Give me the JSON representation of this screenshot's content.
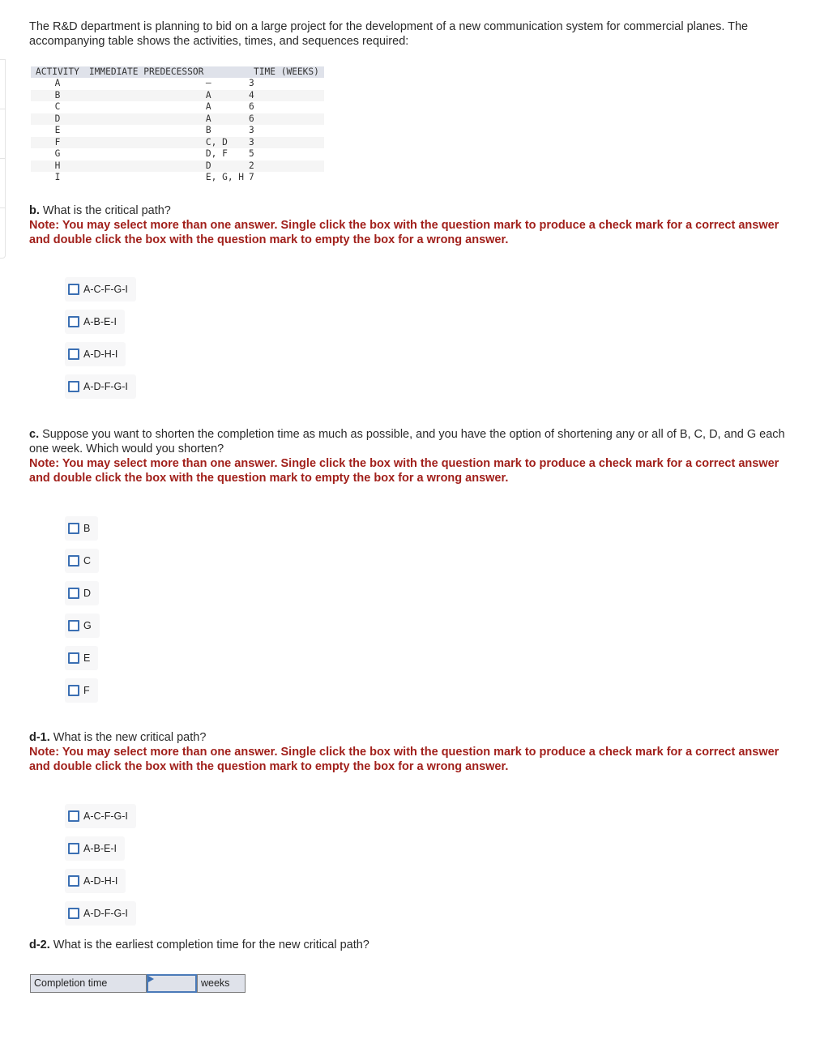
{
  "intro": "The R&D department is planning to bid on a large project for the development of a new communication system for commercial planes. The accompanying table shows the activities, times, and sequences required:",
  "table": {
    "headers": [
      "ACTIVITY",
      "IMMEDIATE PREDECESSOR",
      "TIME (WEEKS)"
    ],
    "rows": [
      {
        "activity": "A",
        "predecessor": "—",
        "time": "3"
      },
      {
        "activity": "B",
        "predecessor": "A",
        "time": "4"
      },
      {
        "activity": "C",
        "predecessor": "A",
        "time": "6"
      },
      {
        "activity": "D",
        "predecessor": "A",
        "time": "6"
      },
      {
        "activity": "E",
        "predecessor": "B",
        "time": "3"
      },
      {
        "activity": "F",
        "predecessor": "C, D",
        "time": "3"
      },
      {
        "activity": "G",
        "predecessor": "D, F",
        "time": "5"
      },
      {
        "activity": "H",
        "predecessor": "D",
        "time": "2"
      },
      {
        "activity": "I",
        "predecessor": "E, G, H",
        "time": "7"
      }
    ]
  },
  "note": "Note: You may select more than one answer. Single click the box with the question mark to produce a check mark for a correct answer and double click the box with the question mark to empty the box for a wrong answer.",
  "q_b": {
    "label": "b.",
    "text": " What is the critical path?",
    "options": [
      {
        "label": "A-C-F-G-I",
        "checked": false
      },
      {
        "label": "A-B-E-I",
        "checked": false
      },
      {
        "label": "A-D-H-I",
        "checked": false
      },
      {
        "label": "A-D-F-G-I",
        "checked": false
      }
    ]
  },
  "q_c": {
    "label": "c.",
    "text": " Suppose you want to shorten the completion time as much as possible, and you have the option of shortening any or all of B, C, D, and G each one week. Which would you shorten?",
    "options": [
      {
        "label": "B",
        "checked": false
      },
      {
        "label": "C",
        "checked": false
      },
      {
        "label": "D",
        "checked": false
      },
      {
        "label": "G",
        "checked": false
      },
      {
        "label": "E",
        "checked": false
      },
      {
        "label": "F",
        "checked": false
      }
    ]
  },
  "q_d1": {
    "label": "d-1.",
    "text": " What is the new critical path?",
    "options": [
      {
        "label": "A-C-F-G-I",
        "checked": false
      },
      {
        "label": "A-B-E-I",
        "checked": false
      },
      {
        "label": "A-D-H-I",
        "checked": false
      },
      {
        "label": "A-D-F-G-I",
        "checked": false
      }
    ]
  },
  "q_d2": {
    "label": "d-2.",
    "text": " What is the earliest completion time for the new critical path?",
    "field_label": "Completion time",
    "value": "",
    "unit": "weeks"
  }
}
